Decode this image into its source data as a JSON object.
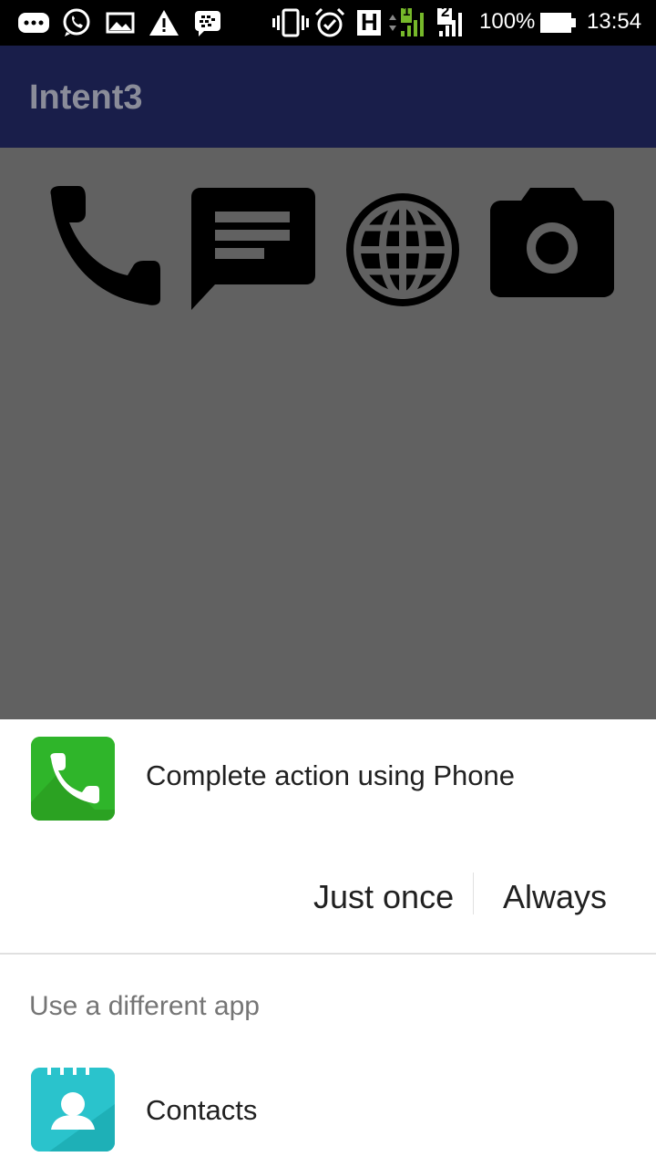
{
  "status_bar": {
    "battery_percent": "100%",
    "time": "13:54",
    "network_type": "H",
    "sim1_label": "1",
    "sim2_label": "2",
    "icons": [
      "message-bubble-icon",
      "whatsapp-icon",
      "gallery-icon",
      "warning-icon",
      "bbm-icon",
      "vibrate-icon",
      "alarm-icon",
      "network-h-icon",
      "signal-sim1-icon",
      "signal-sim2-icon",
      "battery-icon"
    ],
    "colors": {
      "background": "#000000",
      "sim1_signal": "#76b82a"
    }
  },
  "app_bar": {
    "title": "Intent3",
    "color": "#191e4a"
  },
  "actions": {
    "icons": [
      "phone-icon",
      "message-icon",
      "globe-icon",
      "camera-icon"
    ]
  },
  "chooser": {
    "title": "Complete action using Phone",
    "app_icon": "phone-app-icon",
    "just_once_label": "Just once",
    "always_label": "Always",
    "different_app_label": "Use a different app",
    "apps": [
      {
        "label": "Contacts",
        "icon": "contacts-app-icon"
      }
    ],
    "colors": {
      "phone_green": "#3fae1f",
      "contacts_teal": "#26c6c9",
      "scrim": "#616161"
    }
  }
}
